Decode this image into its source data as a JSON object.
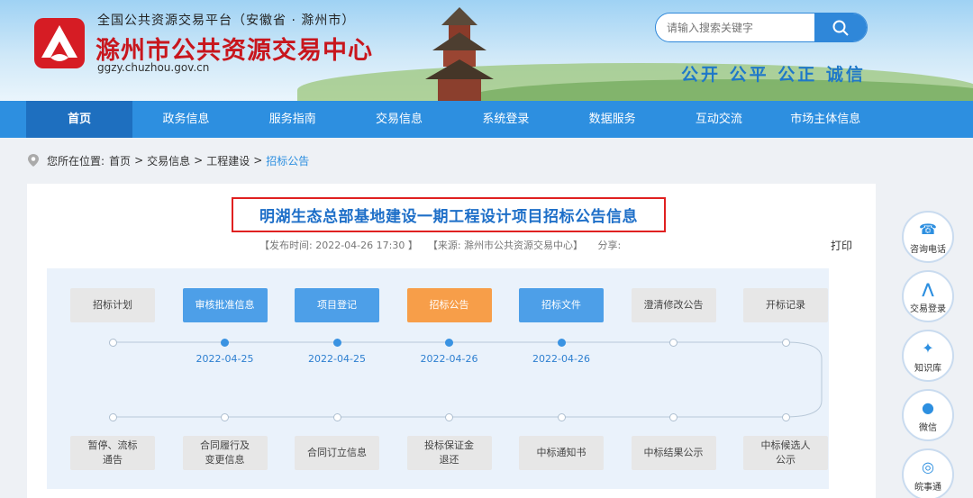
{
  "header": {
    "platform_name": "全国公共资源交易平台（安徽省 · 滁州市）",
    "site_title": "滁州市公共资源交易中心",
    "site_url": "ggzy.chuzhou.gov.cn",
    "search_placeholder": "请输入搜索关键字",
    "slogan": "公开 公平 公正 诚信"
  },
  "nav": {
    "items": [
      "首页",
      "政务信息",
      "服务指南",
      "交易信息",
      "系统登录",
      "数据服务",
      "互动交流",
      "市场主体信息"
    ],
    "active": "首页"
  },
  "breadcrumb": {
    "prefix": "您所在位置:",
    "items": [
      "首页",
      "交易信息",
      "工程建设"
    ],
    "current": "招标公告"
  },
  "article": {
    "title": "明湖生态总部基地建设一期工程设计项目招标公告信息",
    "meta": "【发布时间: 2022-04-26 17:30 】　　【来源: 滁州市公共资源交易中心】　　分享:",
    "print_label": "打印"
  },
  "flow": {
    "top_steps": [
      {
        "label": "招标计划",
        "state": "gray",
        "date": ""
      },
      {
        "label": "审核批准信息",
        "state": "blue",
        "date": "2022-04-25"
      },
      {
        "label": "项目登记",
        "state": "blue",
        "date": "2022-04-25"
      },
      {
        "label": "招标公告",
        "state": "orange",
        "date": "2022-04-26"
      },
      {
        "label": "招标文件",
        "state": "blue",
        "date": "2022-04-26"
      },
      {
        "label": "澄清修改公告",
        "state": "gray",
        "date": ""
      },
      {
        "label": "开标记录",
        "state": "gray",
        "date": ""
      }
    ],
    "bottom_steps": [
      "暂停、流标\n通告",
      "合同履行及\n变更信息",
      "合同订立信息",
      "投标保证金\n退还",
      "中标通知书",
      "中标结果公示",
      "中标候选人\n公示"
    ]
  },
  "sidebar": {
    "items": [
      "咨询电话",
      "交易登录",
      "知识库",
      "微信",
      "皖事通"
    ]
  },
  "colors": {
    "primary": "#2d8fe0",
    "accent": "#f79e49",
    "title_red": "#c8161d"
  }
}
